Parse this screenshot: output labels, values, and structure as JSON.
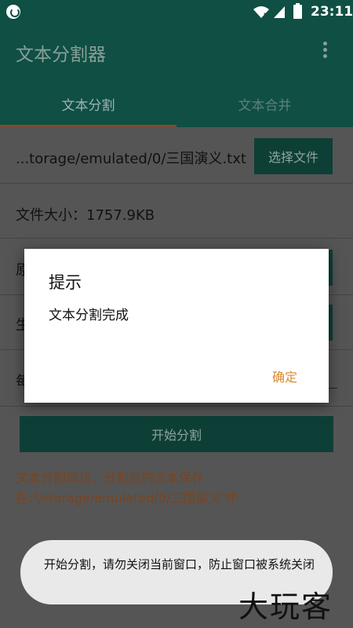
{
  "statusbar": {
    "time": "23:11",
    "icons": [
      "notification-icon",
      "wifi-icon",
      "signal-icon",
      "battery-icon"
    ]
  },
  "appbar": {
    "title": "文本分割器",
    "overflow_icon": "overflow-menu-icon"
  },
  "tabs": [
    {
      "label": "文本分割",
      "active": true
    },
    {
      "label": "文本合并",
      "active": false
    }
  ],
  "file": {
    "path": "...torage/emulated/0/三国演义.txt",
    "choose_button": "选择文件",
    "size_text": "文件大小：1757.9KB"
  },
  "partial_rows": {
    "row3_text": "原",
    "row4_text": "生",
    "row5_text": "每"
  },
  "actions": {
    "start_button": "开始分割"
  },
  "result": {
    "text": "文本分割成功，分割后的文本保存在:\"/storage/emulated/0/三国演义\"中"
  },
  "dialog": {
    "title": "提示",
    "message": "文本分割完成",
    "ok": "确定"
  },
  "toast": {
    "text": "开始分割，请勿关闭当前窗口，防止窗口被系统关闭"
  },
  "watermark": {
    "text": "大玩客"
  },
  "colors": {
    "primary_dark": "#0f4f44",
    "accent": "#d98a2b",
    "result_text": "#7a4420"
  }
}
